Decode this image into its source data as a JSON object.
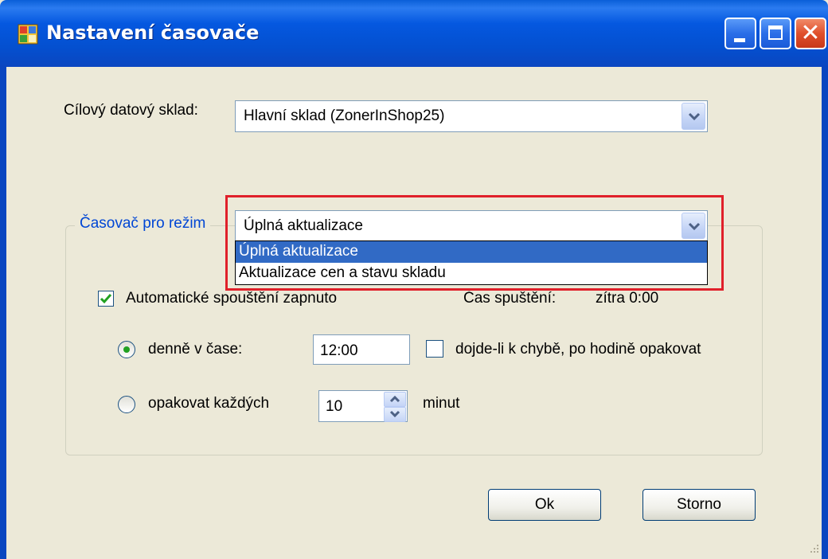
{
  "window": {
    "title": "Nastavení časovače",
    "minimize_icon": "minimize-icon",
    "maximize_icon": "maximize-icon",
    "close_icon": "close-icon",
    "close_glyph": "✕"
  },
  "target": {
    "label": "Cílový datový sklad:",
    "value": "Hlavní sklad (ZonerInShop25)"
  },
  "mode": {
    "group_title": "Časovač pro režim",
    "value": "Úplná aktualizace",
    "options": [
      "Úplná aktualizace",
      "Aktualizace cen a stavu skladu"
    ],
    "selected_index": 0
  },
  "auto": {
    "checkbox_label": "Automatické spouštění zapnuto",
    "checked": true,
    "start_label": "Čas spuštění:",
    "start_value": "zítra 0:00"
  },
  "daily": {
    "label": "denně v čase:",
    "selected": true,
    "time": "12:00",
    "retry_label": "dojde-li k chybě, po hodině opakovat",
    "retry_checked": false
  },
  "repeat": {
    "label": "opakovat každých",
    "selected": false,
    "value": "10",
    "unit": "minut"
  },
  "buttons": {
    "ok": "Ok",
    "cancel": "Storno"
  },
  "colors": {
    "titlebar": "#0558e0",
    "highlight": "#e0202a",
    "selection": "#316ac5",
    "group_title": "#0046d5"
  }
}
